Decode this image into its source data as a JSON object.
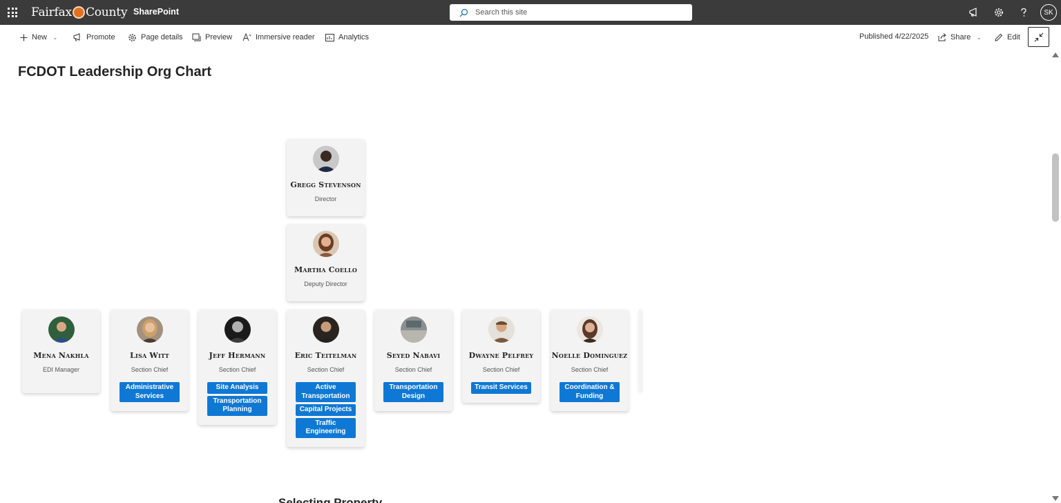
{
  "suite": {
    "org_left": "Fairfax",
    "org_right": "County",
    "app": "SharePoint",
    "search_placeholder": "Search this site",
    "user_initials": "SK"
  },
  "commands": {
    "new": "New",
    "promote": "Promote",
    "page_details": "Page details",
    "preview": "Preview",
    "immersive_reader": "Immersive reader",
    "analytics": "Analytics",
    "published": "Published 4/22/2025",
    "share": "Share",
    "edit": "Edit"
  },
  "page": {
    "title": "FCDOT Leadership Org Chart",
    "next_section_heading": "Selecting Property"
  },
  "org": {
    "director": {
      "name": "Gregg Stevenson",
      "role": "Director"
    },
    "deputy": {
      "name": "Martha Coello",
      "role": "Deputy Director"
    },
    "staff": [
      {
        "name": "Mena Nakhla",
        "role": "EDI Manager",
        "units": []
      },
      {
        "name": "Lisa Witt",
        "role": "Section Chief",
        "units": [
          "Administrative Services"
        ]
      },
      {
        "name": "Jeff Hermann",
        "role": "Section Chief",
        "units": [
          "Site Analysis",
          "Transportation Planning"
        ]
      },
      {
        "name": "Eric Teitelman",
        "role": "Section Chief",
        "units": [
          "Active Transportation",
          "Capital Projects",
          "Traffic Engineering"
        ]
      },
      {
        "name": "Seyed Nabavi",
        "role": "Section Chief",
        "units": [
          "Transportation Design"
        ]
      },
      {
        "name": "Dwayne Pelfrey",
        "role": "Section Chief",
        "units": [
          "Transit Services"
        ]
      },
      {
        "name": "Noelle Dominguez",
        "role": "Section Chief",
        "units": [
          "Coordination & Funding"
        ]
      }
    ]
  },
  "colors": {
    "suite_bar": "#3b3b3b",
    "unit_tag": "#0f78d4",
    "card": "#f3f3f3"
  }
}
